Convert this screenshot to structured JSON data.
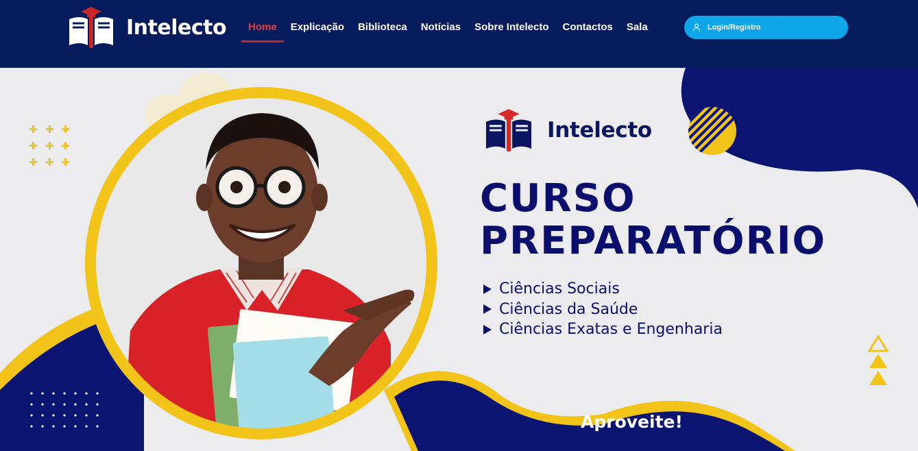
{
  "header": {
    "logo_text": "Intelecto",
    "nav": [
      {
        "label": "Home",
        "active": true
      },
      {
        "label": "Explicação",
        "active": false
      },
      {
        "label": "Biblioteca",
        "active": false
      },
      {
        "label": "Notícias",
        "active": false
      },
      {
        "label": "Sobre Intelecto",
        "active": false
      },
      {
        "label": "Contactos",
        "active": false
      },
      {
        "label": "Sala",
        "active": false
      }
    ],
    "login_label": "Login/Registro",
    "login_icon": "user-icon"
  },
  "hero": {
    "logo_text": "Intelecto",
    "title_line1": "CURSO",
    "title_line2": "PREPARATÓRIO",
    "items": [
      "Ciências Sociais",
      "Ciências da Saúde",
      "Ciências Exatas e Engenharia"
    ],
    "cta": "Aproveite!"
  },
  "colors": {
    "header_bg": "#061b5c",
    "navy": "#0a0f6e",
    "yellow": "#f2c318",
    "accent_red": "#e73b3b",
    "login_blue": "#0ea5e9"
  }
}
